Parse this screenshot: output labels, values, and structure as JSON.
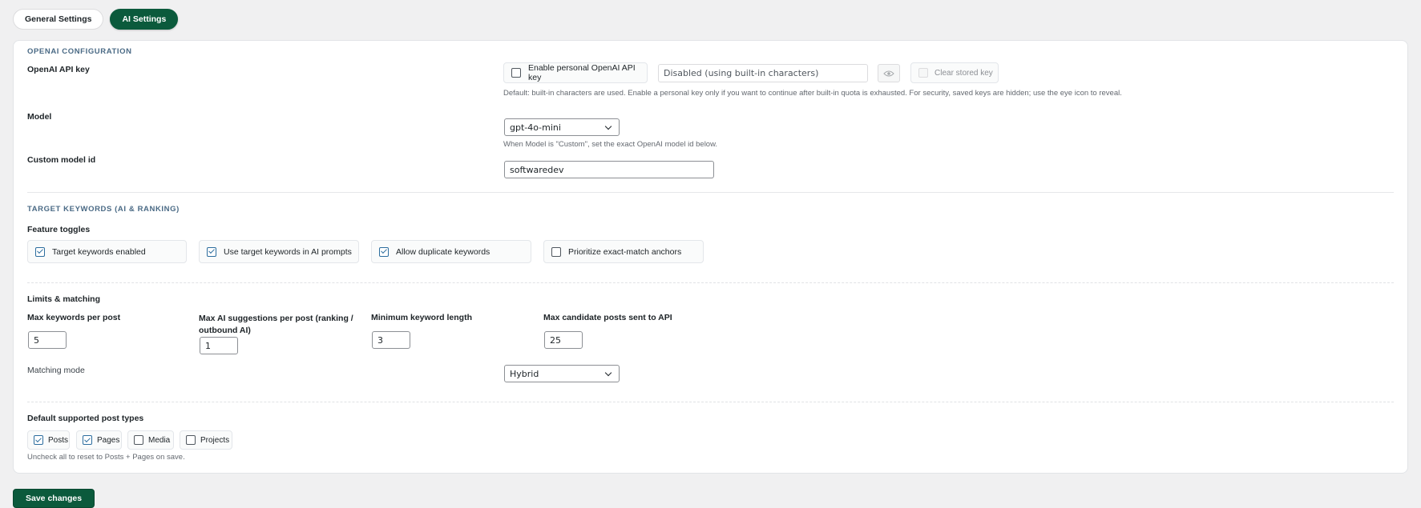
{
  "tabs": {
    "general": "General Settings",
    "ai": "AI Settings"
  },
  "openai": {
    "section_title": "OpenAI Configuration",
    "api_key_label": "OpenAI API key",
    "enable_personal_label": "Enable personal OpenAI API key",
    "enable_personal_checked": false,
    "api_key_value": "Disabled (using built-in characters)",
    "eye_icon": "eye-icon",
    "clear_key_label": "Clear stored key",
    "api_key_hint": "Default: built-in characters are used. Enable a personal key only if you want to continue after built-in quota is exhausted. For security, saved keys are hidden; use the eye icon to reveal.",
    "model_label": "Model",
    "model_value": "gpt-4o-mini",
    "model_hint": "When Model is \"Custom\", set the exact OpenAI model id below.",
    "custom_model_label": "Custom model id",
    "custom_model_value": "softwaredev"
  },
  "keywords": {
    "section_title": "Target Keywords (AI & Ranking)",
    "toggles_label": "Feature toggles",
    "toggles": [
      {
        "label": "Target keywords enabled",
        "checked": true
      },
      {
        "label": "Use target keywords in AI prompts",
        "checked": true
      },
      {
        "label": "Allow duplicate keywords",
        "checked": true
      },
      {
        "label": "Prioritize exact-match anchors",
        "checked": false
      }
    ],
    "limits_label": "Limits & matching",
    "max_keywords_label": "Max keywords per post",
    "max_keywords_value": "5",
    "max_ai_label_line1": "Max AI suggestions per post (ranking /",
    "max_ai_label_line2": "outbound AI)",
    "max_ai_value": "1",
    "min_length_label": "Minimum keyword length",
    "min_length_value": "3",
    "max_candidates_label": "Max candidate posts sent to API",
    "max_candidates_value": "25",
    "matching_mode_label": "Matching mode",
    "matching_mode_value": "Hybrid"
  },
  "post_types": {
    "label": "Default supported post types",
    "items": [
      {
        "label": "Posts",
        "checked": true
      },
      {
        "label": "Pages",
        "checked": true
      },
      {
        "label": "Media",
        "checked": false
      },
      {
        "label": "Projects",
        "checked": false
      }
    ],
    "hint": "Uncheck all to reset to Posts + Pages on save."
  },
  "save_label": "Save changes",
  "colors": {
    "accent": "#0b5a3c",
    "section_title": "#4a6a85",
    "checkbox": "#2c6d9e"
  }
}
